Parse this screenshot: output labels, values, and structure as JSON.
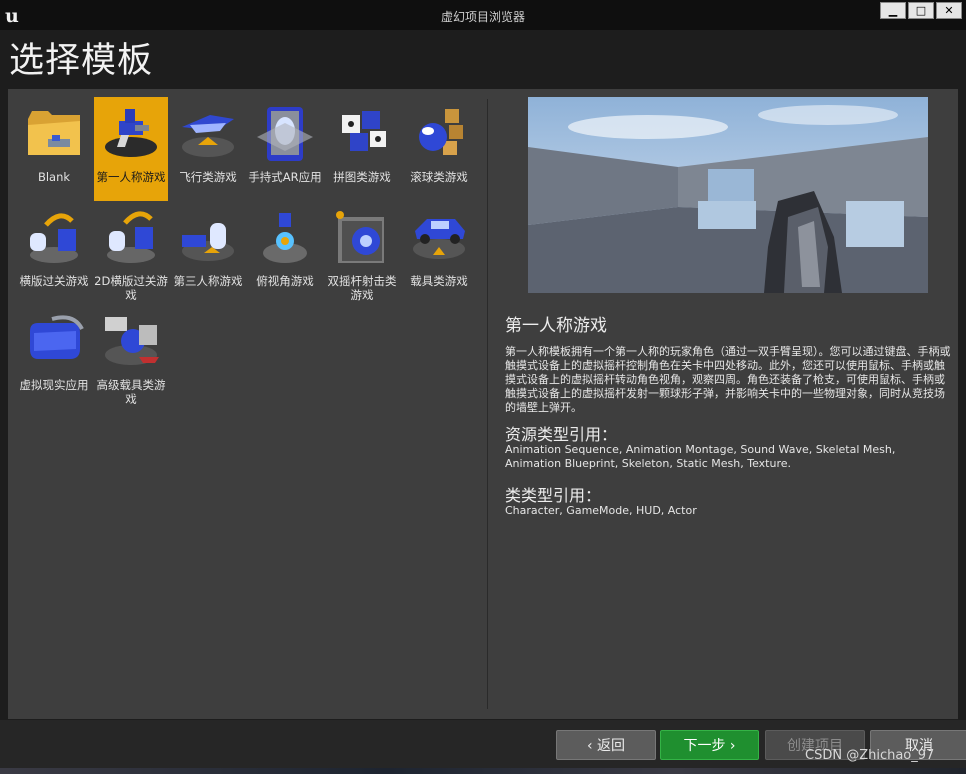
{
  "window": {
    "title": "虚幻项目浏览器",
    "controls": {
      "minimize": "▁",
      "maximize": "□",
      "close": "✕"
    }
  },
  "page": {
    "heading": "选择模板"
  },
  "templates": [
    {
      "label": "Blank",
      "icon": "blank-folder-icon",
      "selected": false
    },
    {
      "label": "第一人称游戏",
      "icon": "first-person-icon",
      "selected": true
    },
    {
      "label": "飞行类游戏",
      "icon": "flying-icon",
      "selected": false
    },
    {
      "label": "手持式AR应用",
      "icon": "handheld-ar-icon",
      "selected": false
    },
    {
      "label": "拼图类游戏",
      "icon": "puzzle-icon",
      "selected": false
    },
    {
      "label": "滚球类游戏",
      "icon": "rolling-icon",
      "selected": false
    },
    {
      "label": "横版过关游戏",
      "icon": "side-scroller-icon",
      "selected": false
    },
    {
      "label": "2D横版过关游戏",
      "icon": "side-scroller-2d-icon",
      "selected": false
    },
    {
      "label": "第三人称游戏",
      "icon": "third-person-icon",
      "selected": false
    },
    {
      "label": "俯视角游戏",
      "icon": "top-down-icon",
      "selected": false
    },
    {
      "label": "双摇杆射击类游戏",
      "icon": "twin-stick-icon",
      "selected": false
    },
    {
      "label": "载具类游戏",
      "icon": "vehicle-icon",
      "selected": false
    },
    {
      "label": "虚拟现实应用",
      "icon": "vr-headset-icon",
      "selected": false
    },
    {
      "label": "高级载具类游戏",
      "icon": "advanced-vehicle-icon",
      "selected": false
    }
  ],
  "details": {
    "title": "第一人称游戏",
    "description": "第一人称模板拥有一个第一人称的玩家角色（通过一双手臂呈现）。您可以通过键盘、手柄或触摸式设备上的虚拟摇杆控制角色在关卡中四处移动。此外，您还可以使用鼠标、手柄或触摸式设备上的虚拟摇杆转动角色视角，观察四周。角色还装备了枪支，可使用鼠标、手柄或触摸式设备上的虚拟摇杆发射一颗球形子弹，并影响关卡中的一些物理对象，同时从竞技场的墙壁上弹开。",
    "asset_types_title": "资源类型引用：",
    "asset_types": "Animation Sequence, Animation Montage, Sound Wave, Skeletal Mesh, Animation Blueprint, Skeleton, Static Mesh, Texture.",
    "class_types_title": "类类型引用：",
    "class_types": "Character, GameMode, HUD, Actor"
  },
  "buttons": {
    "back": "‹ 返回",
    "next": "下一步 ›",
    "create": "创建项目",
    "cancel": "取消"
  },
  "watermark": "CSDN @Zhichao_97",
  "colors": {
    "selected_tile": "#e7a409",
    "next_button": "#1f8f2f",
    "panel": "#3e3e3e"
  }
}
